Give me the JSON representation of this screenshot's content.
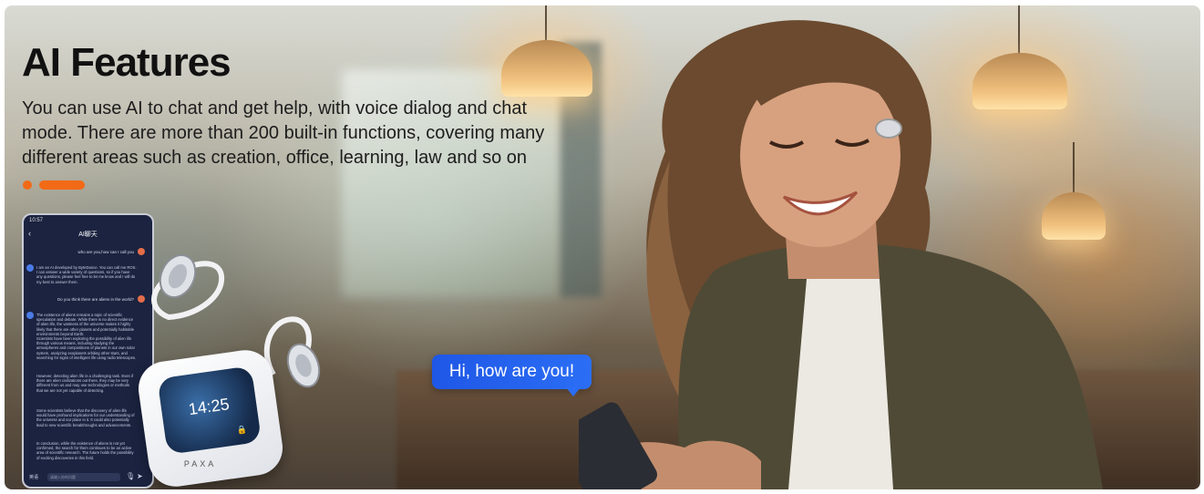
{
  "hero": {
    "title": "AI Features",
    "description": "You can use AI to chat and get help, with voice dialog and chat mode. There are more than 200 built-in functions, covering many different areas such as creation, office, learning, law and so on"
  },
  "colors": {
    "accent": "#f26a16",
    "bubble": "#2b6ef5",
    "phone_bg": "#1b2340"
  },
  "phone": {
    "status_time": "10:57",
    "header_title": "AI聊天",
    "messages": [
      {
        "side": "right",
        "text": "who are you,how can I call you"
      },
      {
        "side": "left",
        "text": "I am an AI developed by ByteDance. You can call me ROS. I can answer a wide variety of questions, so if you have any questions, please feel free to let me know and I will do my best to answer them."
      },
      {
        "side": "right",
        "text": "Do you think there are aliens in the world?"
      },
      {
        "side": "left",
        "text": "The existence of aliens remains a topic of scientific speculation and debate. While there is no direct evidence of alien life, the vastness of the universe makes it highly likely that there are other planets and potentially habitable environments beyond Earth."
      },
      {
        "side": "left",
        "text": "Scientists have been exploring the possibility of alien life through various means, including studying the atmospheres and compositions of planets in our own solar system, analyzing exoplanets orbiting other stars, and searching for signs of intelligent life using radio telescopes."
      },
      {
        "side": "left",
        "text": "However, detecting alien life is a challenging task. Even if there are alien civilizations out there, they may be very different from us and may use technologies or methods that we are not yet capable of detecting."
      },
      {
        "side": "left",
        "text": "Some scientists believe that the discovery of alien life would have profound implications for our understanding of the universe and our place in it. It could also potentially lead to new scientific breakthroughs and advancements."
      },
      {
        "side": "left",
        "text": "In conclusion, while the existence of aliens is not yet confirmed, the search for them continues to be an active area of scientific research. The future holds the possibility of exciting discoveries in this field."
      }
    ],
    "input_mode": "英语",
    "input_placeholder": "请输入你的问题"
  },
  "case": {
    "time": "14:25",
    "brand": "PAXA"
  },
  "chat_bubble": {
    "text": "Hi, how are you!"
  },
  "icons": [
    "back-arrow-icon",
    "mic-icon",
    "send-icon",
    "user-avatar-icon",
    "ai-avatar-icon",
    "lock-icon"
  ]
}
